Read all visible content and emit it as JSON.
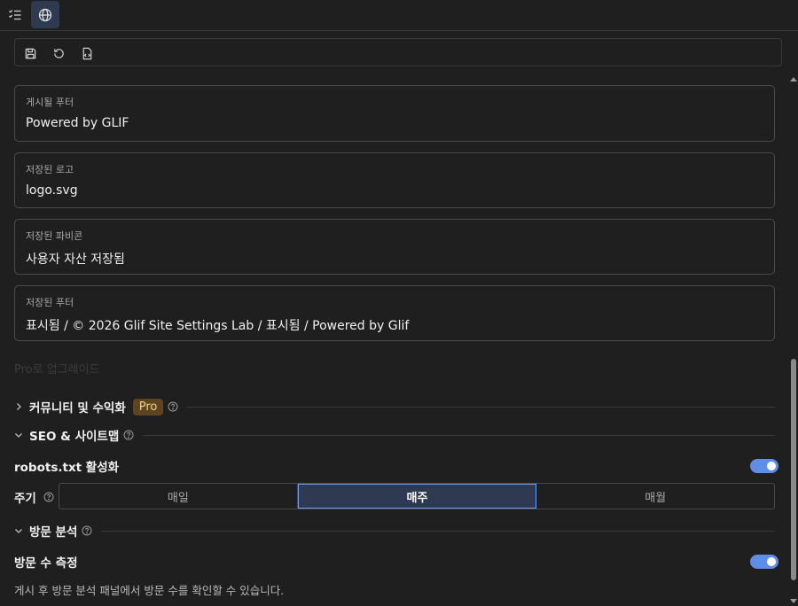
{
  "topbar": {
    "buttons": [
      {
        "icon": "checklist-icon"
      },
      {
        "icon": "globe-icon",
        "active": true
      }
    ]
  },
  "toolbar": {
    "buttons": [
      {
        "icon": "save-icon"
      },
      {
        "icon": "reset-icon"
      },
      {
        "icon": "code-file-icon"
      }
    ]
  },
  "fields": {
    "published_footer": {
      "label": "게시될 푸터",
      "value": "Powered by GLIF"
    },
    "saved_logo": {
      "label": "저장된 로고",
      "value": "logo.svg"
    },
    "saved_favicon": {
      "label": "저장된 파비콘",
      "value": "사용자 자산 저장됨"
    },
    "saved_footer": {
      "label": "저장된 푸터",
      "value": "표시됨 / © 2026 Glif Site Settings Lab / 표시됨 / Powered by Glif"
    }
  },
  "upgrade_text": "Pro로 업그레이드",
  "sections": {
    "community": {
      "title": "커뮤니티 및 수익화",
      "badge": "Pro",
      "collapsed": true
    },
    "seo": {
      "title": "SEO & 사이트맵",
      "collapsed": false,
      "robots_label": "robots.txt 활성화",
      "robots_enabled": true,
      "frequency_label": "주기",
      "frequency_options": [
        "매일",
        "매주",
        "매월"
      ],
      "frequency_selected": "매주"
    },
    "analytics": {
      "title": "방문 분석",
      "collapsed": false,
      "visits_label": "방문 수 측정",
      "visits_enabled": true,
      "description": "게시 후 방문 분석 패널에서 방문 수를 확인할 수 있습니다."
    }
  },
  "colors": {
    "background": "#1f1f1f",
    "accent": "#5f8ee8",
    "pro_badge_bg": "#5c4520",
    "pro_badge_text": "#f2cf8c"
  }
}
